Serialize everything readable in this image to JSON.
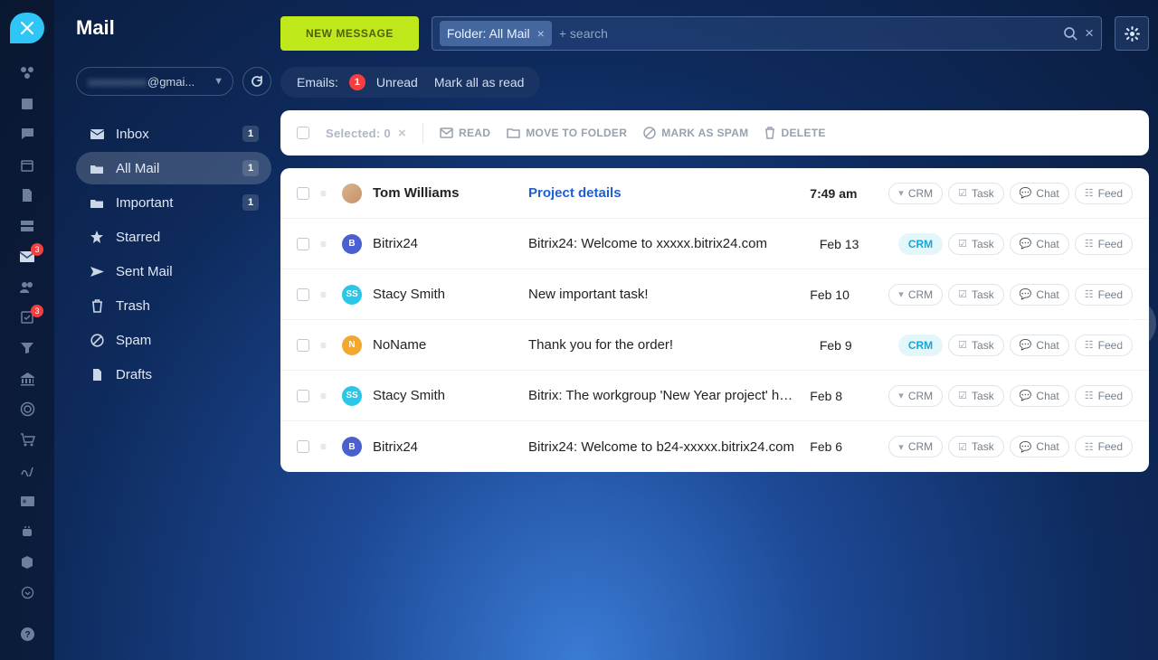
{
  "page_title": "Mail",
  "account": {
    "blurred_prefix": "xxxxxxxxxx",
    "visible": "@gmai..."
  },
  "new_message_label": "NEW MESSAGE",
  "search": {
    "chip_label": "Folder: All Mail",
    "placeholder": "+ search"
  },
  "filter": {
    "emails_label": "Emails:",
    "unread_count": "1",
    "unread_label": "Unread",
    "mark_all_label": "Mark all as read"
  },
  "toolbar": {
    "selected_label": "Selected: 0",
    "read": "READ",
    "move": "MOVE TO FOLDER",
    "spam": "MARK AS SPAM",
    "delete": "DELETE"
  },
  "folders": [
    {
      "icon": "inbox",
      "label": "Inbox",
      "count": "1"
    },
    {
      "icon": "allmail",
      "label": "All Mail",
      "count": "1",
      "active": true
    },
    {
      "icon": "folder",
      "label": "Important",
      "count": "1"
    },
    {
      "icon": "star",
      "label": "Starred"
    },
    {
      "icon": "sent",
      "label": "Sent Mail"
    },
    {
      "icon": "trash",
      "label": "Trash"
    },
    {
      "icon": "spam",
      "label": "Spam"
    },
    {
      "icon": "drafts",
      "label": "Drafts"
    }
  ],
  "tags": {
    "crm": "CRM",
    "task": "Task",
    "chat": "Chat",
    "feed": "Feed"
  },
  "messages": [
    {
      "sender": "Tom Williams",
      "subject": "Project details",
      "date": "7:49 am",
      "avatar": "photo",
      "unread": true,
      "crm_hl": false
    },
    {
      "sender": "Bitrix24",
      "subject": "Bitrix24: Welcome to xxxxx.bitrix24.com",
      "date": "Feb 13",
      "avatar": "B",
      "avc": "av-b",
      "crm_hl": true
    },
    {
      "sender": "Stacy Smith",
      "subject": "New important task!",
      "date": "Feb 10",
      "avatar": "SS",
      "avc": "av-ss",
      "crm_hl": false
    },
    {
      "sender": "NoName",
      "subject": "Thank you for the order!",
      "date": "Feb 9",
      "avatar": "N",
      "avc": "av-n",
      "crm_hl": true
    },
    {
      "sender": "Stacy Smith",
      "subject": "Bitrix: The workgroup 'New Year project' has been archived.",
      "date": "Feb 8",
      "avatar": "SS",
      "avc": "av-ss",
      "crm_hl": false
    },
    {
      "sender": "Bitrix24",
      "subject": "Bitrix24: Welcome to b24-xxxxx.bitrix24.com",
      "date": "Feb 6",
      "avatar": "B",
      "avc": "av-b",
      "crm_hl": false
    }
  ],
  "rail_badges": {
    "mail": "3",
    "tasks": "3"
  }
}
